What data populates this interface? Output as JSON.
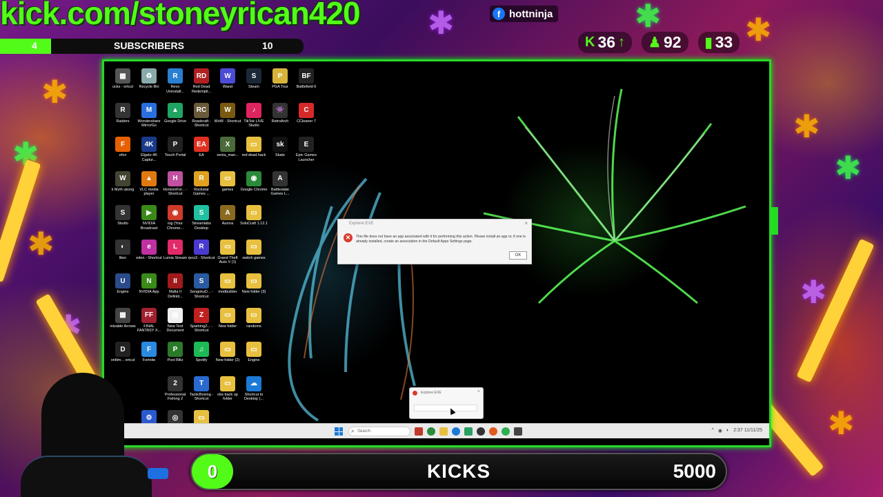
{
  "overlay": {
    "kick_url": "kick.com/stoneyrican420",
    "subscribers": {
      "current": "4",
      "label": "SUBSCRIBERS",
      "goal": "10",
      "progress": 0.4
    },
    "facebook": {
      "handle": "hottninja",
      "icon": "facebook-icon"
    },
    "stats": [
      {
        "icon": "kick-icon",
        "value": "36",
        "arrow": "up-arrow-icon"
      },
      {
        "icon": "follower-icon",
        "value": "92"
      },
      {
        "icon": "signal-bars-icon",
        "value": "33"
      }
    ],
    "kicks": {
      "current": "0",
      "label": "KICKS",
      "goal": "5000"
    },
    "colors": {
      "kick_green": "#53fc18",
      "frame_green": "#2ad62a"
    }
  },
  "desktop": {
    "icons": [
      {
        "label": "ucks - ortcut",
        "color": "#555",
        "glyph": "▦"
      },
      {
        "label": "Recycle Bin",
        "color": "#8aa",
        "glyph": "♻"
      },
      {
        "label": "Revo Uninstall...",
        "color": "#2a7fd0",
        "glyph": "R"
      },
      {
        "label": "Red Dead Redempti...",
        "color": "#b02020",
        "glyph": "RD"
      },
      {
        "label": "Wand",
        "color": "#4b4bd6",
        "glyph": "W"
      },
      {
        "label": "Steam",
        "color": "#1b2838",
        "glyph": "S"
      },
      {
        "label": "PGA Tour",
        "color": "#d6b43a",
        "glyph": "P"
      },
      {
        "label": "Battlefield 6",
        "color": "#222",
        "glyph": "BF"
      },
      {
        "label": "Raiders",
        "color": "#333",
        "glyph": "R"
      },
      {
        "label": "Wondershare MirrorGo",
        "color": "#2a6fe0",
        "glyph": "M"
      },
      {
        "label": "Google Drive",
        "color": "#1fa463",
        "glyph": "▲"
      },
      {
        "label": "Roadcraft - Shortcut",
        "color": "#6a5a3a",
        "glyph": "RC"
      },
      {
        "label": "WoW - Shortcut",
        "color": "#7a5a10",
        "glyph": "W"
      },
      {
        "label": "TikTok LIVE Studio",
        "color": "#e0245e",
        "glyph": "♪"
      },
      {
        "label": "RetroArch",
        "color": "#333",
        "glyph": "👾"
      },
      {
        "label": "CCleaner 7",
        "color": "#d62a2a",
        "glyph": "C"
      },
      {
        "label": "efox",
        "color": "#e66000",
        "glyph": "F"
      },
      {
        "label": "Elgato 4K Captur...",
        "color": "#1a3a8a",
        "glyph": "4K"
      },
      {
        "label": "Touch Portal",
        "color": "#222",
        "glyph": "P"
      },
      {
        "label": "EA",
        "color": "#e03020",
        "glyph": "EA"
      },
      {
        "label": "xenia_man...",
        "color": "#4a6a3a",
        "glyph": "X"
      },
      {
        "label": "red dead.hack",
        "color": "#e8c040",
        "glyph": "▭"
      },
      {
        "label": "Skate",
        "color": "#111",
        "glyph": "sk"
      },
      {
        "label": "Epic Games Launcher",
        "color": "#222",
        "glyph": "E"
      },
      {
        "label": "k Myth ukong",
        "color": "#443",
        "glyph": "W"
      },
      {
        "label": "VLC media player",
        "color": "#e07a10",
        "glyph": "▲"
      },
      {
        "label": "HorizonFor... - Shortcut",
        "color": "#c050a0",
        "glyph": "H"
      },
      {
        "label": "Rockstar Games ...",
        "color": "#e0a020",
        "glyph": "R"
      },
      {
        "label": "games",
        "color": "#e8c040",
        "glyph": "▭"
      },
      {
        "label": "Google Chrome",
        "color": "#2a8a3a",
        "glyph": "◉"
      },
      {
        "label": "Battlestate Games L...",
        "color": "#333",
        "glyph": "A"
      },
      {
        "label": "",
        "color": "#000",
        "glyph": ""
      },
      {
        "label": "Studio",
        "color": "#333",
        "glyph": "S"
      },
      {
        "label": "NVIDIA Broadcast",
        "color": "#3a8a1a",
        "glyph": "▶"
      },
      {
        "label": "ing (Your Chrome...",
        "color": "#d03a2a",
        "glyph": "◉"
      },
      {
        "label": "Streamlabs Desktop",
        "color": "#20c0a0",
        "glyph": "S"
      },
      {
        "label": "Aurora",
        "color": "#8a6a20",
        "glyph": "A"
      },
      {
        "label": "SoloCraft 1.12.1",
        "color": "#e8c040",
        "glyph": "▭"
      },
      {
        "label": "",
        "color": "#000",
        "glyph": ""
      },
      {
        "label": "",
        "color": "#000",
        "glyph": ""
      },
      {
        "label": "liber",
        "color": "#333",
        "glyph": "◐"
      },
      {
        "label": "eden - Shortcut",
        "color": "#c030a0",
        "glyph": "e"
      },
      {
        "label": "Lumia Stream",
        "color": "#e02a6a",
        "glyph": "L"
      },
      {
        "label": "rpcs3 - Shortcut",
        "color": "#4a3ad0",
        "glyph": "R"
      },
      {
        "label": "Grand Theft Auto V (1)",
        "color": "#e8c040",
        "glyph": "▭"
      },
      {
        "label": "switch games",
        "color": "#e8c040",
        "glyph": "▭"
      },
      {
        "label": "",
        "color": "#000",
        "glyph": ""
      },
      {
        "label": "",
        "color": "#000",
        "glyph": ""
      },
      {
        "label": "Engine",
        "color": "#2a4a8a",
        "glyph": "U"
      },
      {
        "label": "NVIDIA App",
        "color": "#3a8a1a",
        "glyph": "N"
      },
      {
        "label": "Mafia II Definiti...",
        "color": "#a01a1a",
        "glyph": "II"
      },
      {
        "label": "SengokuD... - Shortcut",
        "color": "#2a5aa0",
        "glyph": "S"
      },
      {
        "label": "modbuilder",
        "color": "#e8c040",
        "glyph": "▭"
      },
      {
        "label": "New folder (3)",
        "color": "#e8c040",
        "glyph": "▭"
      },
      {
        "label": "",
        "color": "#000",
        "glyph": ""
      },
      {
        "label": "",
        "color": "#000",
        "glyph": ""
      },
      {
        "label": "mizable Arrows",
        "color": "#444",
        "glyph": "▦"
      },
      {
        "label": "FINAL FANTASY X...",
        "color": "#a02030",
        "glyph": "FF"
      },
      {
        "label": "New Text Document",
        "color": "#f0f0f0",
        "glyph": "▤"
      },
      {
        "label": "SparkingZ... - Shortcut",
        "color": "#c02020",
        "glyph": "Z"
      },
      {
        "label": "New folder",
        "color": "#e8c040",
        "glyph": "▭"
      },
      {
        "label": "randoms",
        "color": "#e8c040",
        "glyph": "▭"
      },
      {
        "label": "",
        "color": "#000",
        "glyph": ""
      },
      {
        "label": "",
        "color": "#000",
        "glyph": ""
      },
      {
        "label": "ontlim... ortcut",
        "color": "#222",
        "glyph": "D"
      },
      {
        "label": "Fortnite",
        "color": "#2a8ae0",
        "glyph": "F"
      },
      {
        "label": "Pool Blitz",
        "color": "#2a7a2a",
        "glyph": "P"
      },
      {
        "label": "Spotify",
        "color": "#1db954",
        "glyph": "♫"
      },
      {
        "label": "New folder (2)",
        "color": "#e8c040",
        "glyph": "▭"
      },
      {
        "label": "Engine",
        "color": "#e8c040",
        "glyph": "▭"
      },
      {
        "label": "",
        "color": "#000",
        "glyph": ""
      },
      {
        "label": "",
        "color": "#000",
        "glyph": ""
      },
      {
        "label": "",
        "color": "#000",
        "glyph": ""
      },
      {
        "label": "",
        "color": "#c02020",
        "glyph": ""
      },
      {
        "label": "Professional Fishing 2",
        "color": "#333",
        "glyph": "2"
      },
      {
        "label": "TacticBoxing - Shortcut",
        "color": "#2a6ad0",
        "glyph": "T"
      },
      {
        "label": "obs back up folder",
        "color": "#e8c040",
        "glyph": "▭"
      },
      {
        "label": "Shortcut to Desktop (...",
        "color": "#1a7ad6",
        "glyph": "☁"
      },
      {
        "label": "",
        "color": "#000",
        "glyph": ""
      },
      {
        "label": "",
        "color": "#000",
        "glyph": ""
      },
      {
        "label": "",
        "color": "#000",
        "glyph": ""
      },
      {
        "label": "",
        "color": "#2a5ad0",
        "glyph": "⚙"
      },
      {
        "label": "",
        "color": "#333",
        "glyph": "◎"
      },
      {
        "label": "",
        "color": "#e8c040",
        "glyph": "▭"
      }
    ],
    "dialog": {
      "title": "Explorer.EXE",
      "message": "This file does not have an app associated with it for performing this action. Please install an app or, if one is already installed, create an association in the Default Apps Settings page.",
      "ok": "OK",
      "close": "×"
    },
    "taskbar_preview": {
      "title": "Explorer.EXE",
      "close": "×"
    },
    "taskbar": {
      "search_placeholder": "Search",
      "clock": "2:37 11/11/25"
    }
  }
}
